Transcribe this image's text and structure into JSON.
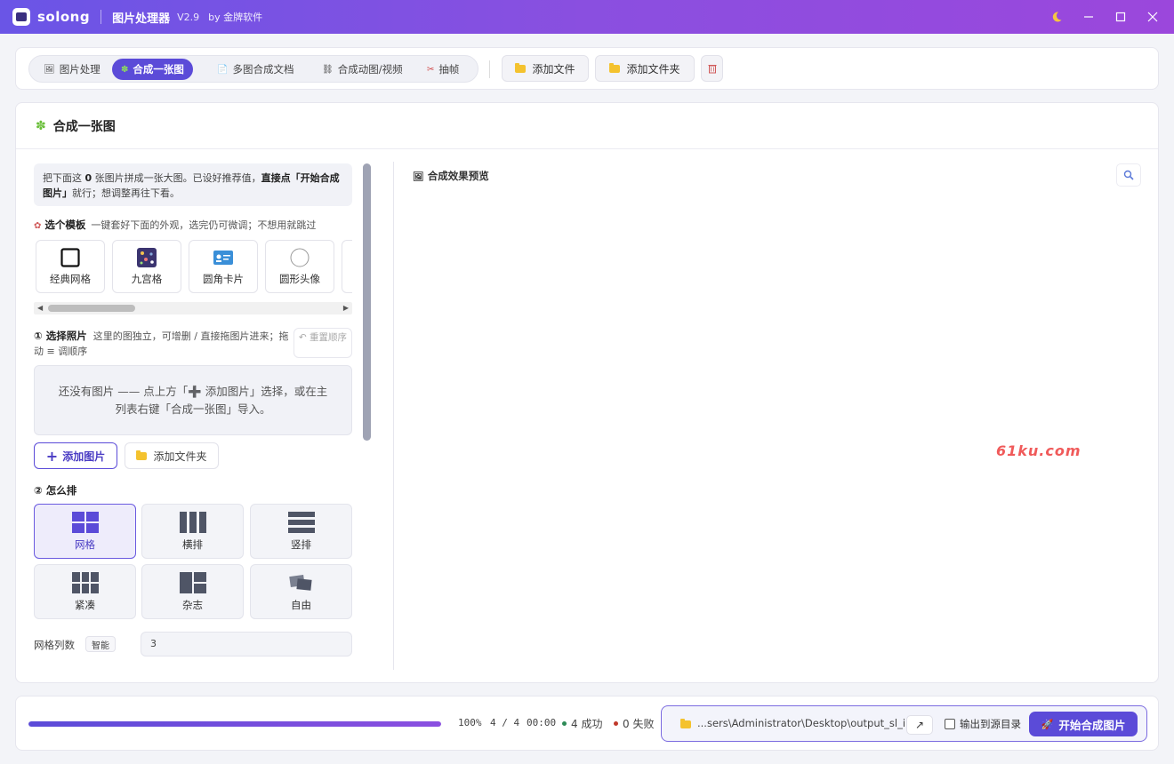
{
  "titlebar": {
    "brand": "solong",
    "app_name": "图片处理器",
    "version": "V2.9",
    "by": "by 金牌软件",
    "icons": [
      "moon-icon",
      "minimize-icon",
      "maximize-icon",
      "close-icon"
    ]
  },
  "tabs": [
    {
      "label": "图片处理",
      "icon": "image-icon",
      "active": false
    },
    {
      "label": "合成一张图",
      "icon": "puzzle-icon",
      "active": true
    },
    {
      "label": "多图合成文档",
      "icon": "document-icon",
      "active": false
    },
    {
      "label": "合成动图/视频",
      "icon": "link-icon",
      "active": false
    },
    {
      "label": "抽帧",
      "icon": "scissors-icon",
      "active": false
    }
  ],
  "toolbar": {
    "add_file": "添加文件",
    "add_folder": "添加文件夹",
    "delete_icon": "trash-icon"
  },
  "main": {
    "title": "合成一张图",
    "info_pre": "把下面这 ",
    "info_count": "0",
    "info_mid": " 张图片拼成一张大图。已设好推荐值，",
    "info_strong": "直接点「开始合成图片」",
    "info_post": "就行；想调整再往下看。",
    "template": {
      "title": "选个模板",
      "subtitle": "一键套好下面的外观，选完仍可微调；不想用就跳过",
      "items": [
        "经典网格",
        "九宫格",
        "圆角卡片",
        "圆形头像"
      ]
    },
    "photos": {
      "title": "① 选择照片",
      "subtitle": "这里的图独立，可增删 / 直接拖图片进来；拖动 ≡ 调顺序",
      "reset": "↶ 重置顺序",
      "empty_text": "还没有图片 —— 点上方「➕ 添加图片」选择，或在主列表右键「合成一张图」导入。",
      "add_images": "添加图片",
      "add_folder": "添加文件夹"
    },
    "layout": {
      "title": "② 怎么排",
      "options": [
        {
          "label": "网格",
          "active": true
        },
        {
          "label": "横排",
          "active": false
        },
        {
          "label": "竖排",
          "active": false
        },
        {
          "label": "紧凑",
          "active": false
        },
        {
          "label": "杂志",
          "active": false
        },
        {
          "label": "自由",
          "active": false
        }
      ]
    },
    "grid_columns": {
      "label": "网格列数",
      "badge": "智能",
      "value": "3"
    },
    "preview": {
      "title": "合成效果预览",
      "zoom_icon": "zoom-icon"
    },
    "watermark": "61ku.com"
  },
  "status": {
    "progress": 1.0,
    "percent": "100%",
    "count": "4 / 4",
    "time": "00:00",
    "success": "4 成功",
    "fail": "0 失败",
    "success_color": "#2e8b57",
    "fail_color": "#c0392b"
  },
  "output": {
    "path": "...sers\\Administrator\\Desktop\\output_sl_ip",
    "open_icon": "open-external-icon",
    "to_source_label": "输出到源目录",
    "to_source_checked": false,
    "start_button": "开始合成图片"
  },
  "colors": {
    "accent": "#5b4bd8",
    "titlebar_start": "#6a55e6",
    "titlebar_end": "#9b47dc"
  }
}
